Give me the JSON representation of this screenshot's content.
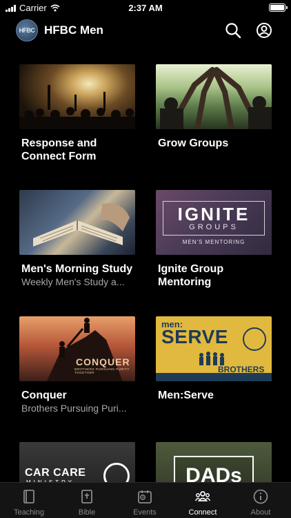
{
  "status_bar": {
    "carrier": "Carrier",
    "time": "2:37 AM"
  },
  "header": {
    "logo_text": "HFBC",
    "title": "HFBC Men",
    "icons": [
      "search-icon",
      "profile-icon"
    ]
  },
  "cards": [
    {
      "title": "Response and Connect Form",
      "subtitle": ""
    },
    {
      "title": "Grow Groups",
      "subtitle": ""
    },
    {
      "title": "Men's Morning Study",
      "subtitle": "Weekly Men's Study a..."
    },
    {
      "title": "Ignite Group Mentoring",
      "subtitle": ""
    },
    {
      "title": "Conquer",
      "subtitle": "Brothers Pursuing Puri..."
    },
    {
      "title": "Men:Serve",
      "subtitle": ""
    },
    {
      "title": "",
      "subtitle": ""
    },
    {
      "title": "",
      "subtitle": ""
    }
  ],
  "thumb_text": {
    "ignite_word": "IGNITE",
    "ignite_groups": "GROUPS",
    "ignite_sub": "MEN'S MENTORING",
    "conquer_word": "CONQUER",
    "conquer_sub": "BROTHERS PURSUING PURITY TOGETHER",
    "serve_men": "men:",
    "serve_word": "SERVE",
    "serve_brothers": "BROTHERS",
    "carcare": "CAR CARE",
    "carcare_ministry": "MINISTRY",
    "dads": "DADs"
  },
  "tabs": [
    {
      "label": "Teaching",
      "icon": "book-icon",
      "active": false
    },
    {
      "label": "Bible",
      "icon": "bible-icon",
      "active": false
    },
    {
      "label": "Events",
      "icon": "calendar-icon",
      "active": false
    },
    {
      "label": "Connect",
      "icon": "people-icon",
      "active": true
    },
    {
      "label": "About",
      "icon": "info-icon",
      "active": false
    }
  ],
  "colors": {
    "background": "#000000",
    "tabbar": "#141414",
    "inactive_tab": "#8a8a8a",
    "subtitle": "#a8a8a8"
  }
}
